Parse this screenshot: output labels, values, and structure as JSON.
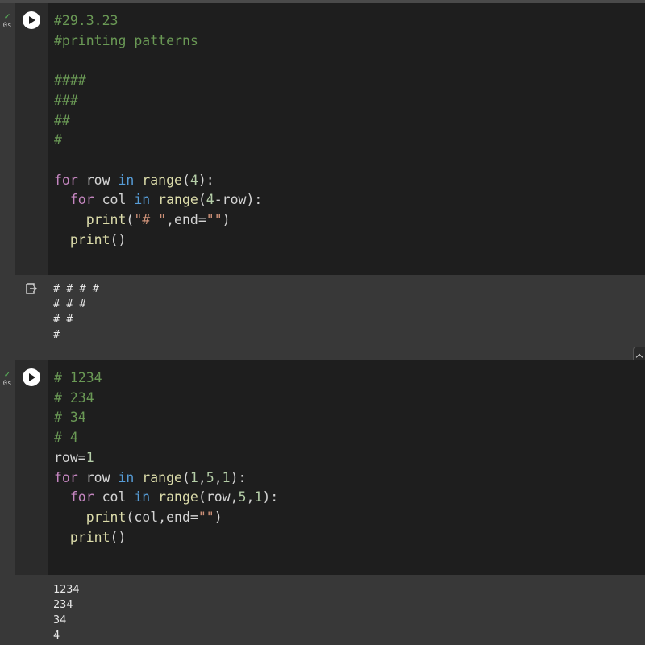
{
  "cells": [
    {
      "status_check": "✓",
      "status_time": "0s",
      "run_icon": "play-icon",
      "code_lines": [
        "#29.3.23",
        "#printing patterns",
        "",
        "####",
        "###",
        "##",
        "#",
        "",
        "for row in range(4):",
        "  for col in range(4-row):",
        "    print(\"# \",end=\"\")",
        "  print()"
      ],
      "output_icon": "output-arrow-icon",
      "output_lines": [
        "# # # #",
        "# # #",
        "# #",
        "#"
      ]
    },
    {
      "status_check": "✓",
      "status_time": "0s",
      "run_icon": "play-icon",
      "code_lines": [
        "# 1234",
        "# 234",
        "# 34",
        "# 4",
        "row=1",
        "for row in range(1,5,1):",
        "  for col in range(row,5,1):",
        "    print(col,end=\"\")",
        "  print()"
      ],
      "output_lines": [
        "1234",
        "234",
        "34",
        "4"
      ]
    }
  ],
  "colors": {
    "editor_bg": "#1e1e1e",
    "comment": "#6a9955",
    "keyword": "#c586c0",
    "builtin": "#569cd6",
    "function": "#dcdcaa",
    "number": "#b5cea8",
    "string": "#ce9178"
  }
}
